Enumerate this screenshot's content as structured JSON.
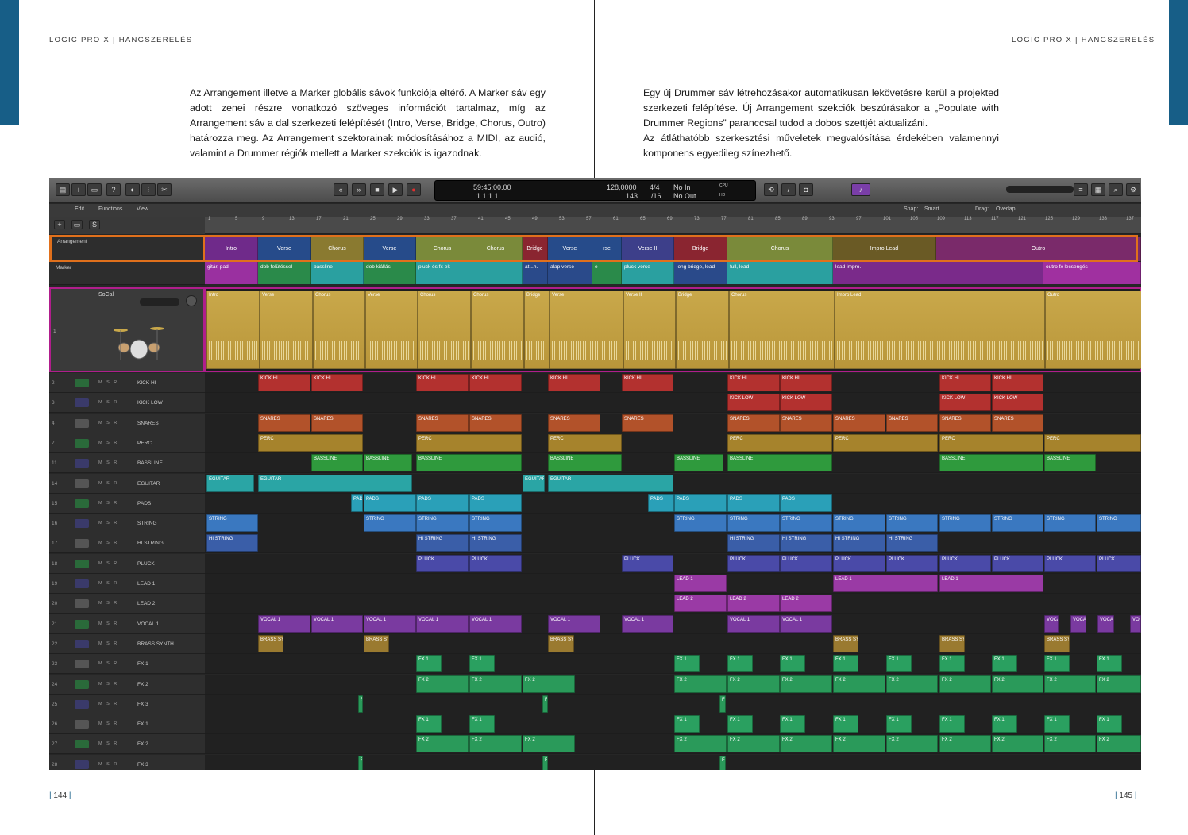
{
  "left_page": {
    "running_head": "LOGIC PRO X | HANGSZERELÉS",
    "paragraph": "Az Arrangement illetve a Marker globális sávok funkciója eltérő. A Marker sáv egy adott zenei részre vonatkozó szöveges információt tartalmaz, míg az Arrangement sáv a dal szerkezeti felépítését (Intro, Verse, Bridge, Chorus, Outro) határozza meg. Az Arrangement szektorainak módosításához a MIDI, az audió, valamint a Drummer régiók mellett a Marker szekciók is igazodnak.",
    "page_number": "144"
  },
  "right_page": {
    "running_head": "LOGIC PRO X | HANGSZERELÉS",
    "paragraph1": "Egy új Drummer sáv létrehozásakor automatikusan lekövetésre kerül a projekted szerkezeti felépítése. Új Arrangement szekciók beszúrásakor a „Populate with Drummer Regions” paranccsal tudod a dobos szettjét aktualizáni.",
    "paragraph2": "Az átláthatóbb szerkesztési műveletek megvalósítása érdekében valamennyi komponens egyedileg színezhető.",
    "page_number": "145"
  },
  "colors": {
    "accent": "#175e87",
    "arrangement_outline": "#e0701c",
    "drummer_outline": "#b01e8c"
  },
  "logic": {
    "lcd": {
      "position": "59:45:00.00",
      "bars": "1  1  1  1",
      "tempo": "128,0000",
      "timesig": "4/4",
      "division": "/16",
      "key_info": "143",
      "in": "No In",
      "out": "No Out",
      "cpu": "CPU",
      "hd": "HD"
    },
    "menu": {
      "edit": "Edit",
      "functions": "Functions",
      "view": "View"
    },
    "snap": {
      "snap_label": "Snap:",
      "snap_value": "Smart",
      "drag_label": "Drag:",
      "drag_value": "Overlap"
    },
    "ruler": [
      "1",
      "5",
      "9",
      "13",
      "17",
      "21",
      "25",
      "29",
      "33",
      "37",
      "41",
      "45",
      "49",
      "53",
      "57",
      "61",
      "65",
      "69",
      "73",
      "77",
      "81",
      "85",
      "89",
      "93",
      "97",
      "101",
      "105",
      "109",
      "113",
      "117",
      "121",
      "125",
      "129",
      "133",
      "137"
    ],
    "arrangement_label": "Arrangement",
    "marker_label": "Marker",
    "drummer_name": "SoCal",
    "drummer_num": "1",
    "arrangement": [
      {
        "label": "Intro",
        "color": "#6f2a8a"
      },
      {
        "label": "Verse",
        "color": "#264b8a"
      },
      {
        "label": "Chorus",
        "color": "#8a7a30"
      },
      {
        "label": "Verse",
        "color": "#264b8a"
      },
      {
        "label": "Chorus",
        "color": "#7a8a3a"
      },
      {
        "label": "Chorus",
        "color": "#7a8a3a"
      },
      {
        "label": "Bridge",
        "color": "#8a2530"
      },
      {
        "label": "Verse",
        "color": "#264b8a"
      },
      {
        "label": "rse",
        "color": "#264b8a"
      },
      {
        "label": "Verse II",
        "color": "#3d3f8a"
      },
      {
        "label": "Bridge",
        "color": "#8a2530"
      },
      {
        "label": "Chorus",
        "color": "#7a8a3a"
      },
      {
        "label": "Impro Lead",
        "color": "#6a5a25"
      },
      {
        "label": "Outro",
        "color": "#7a2a6a"
      }
    ],
    "markers": [
      {
        "label": "gitár, pad",
        "color": "#9a30a0"
      },
      {
        "label": "dob felütéssel",
        "color": "#2a8a4a"
      },
      {
        "label": "bassline",
        "color": "#2aa0a0"
      },
      {
        "label": "dob kiállás",
        "color": "#2a8a4a"
      },
      {
        "label": "pluck és fx-ek",
        "color": "#2aa0a0"
      },
      {
        "label": "at...h.",
        "color": "#2a4a8a"
      },
      {
        "label": "alap verse",
        "color": "#2a4a8a"
      },
      {
        "label": "e",
        "color": "#2a8a4a"
      },
      {
        "label": "pluck verse",
        "color": "#2aa0a0"
      },
      {
        "label": "long bridge, lead",
        "color": "#2a4a8a"
      },
      {
        "label": "full, lead",
        "color": "#2aa0a0"
      },
      {
        "label": "lead impro.",
        "color": "#7a2a8a"
      },
      {
        "label": "outro fx lecsengés",
        "color": "#a030a0"
      }
    ],
    "drummer_regions": [
      "Intro",
      "Verse",
      "Chorus",
      "Verse",
      "Chorus",
      "Chorus",
      "Bridge",
      "Verse",
      "Verse II",
      "Bridge",
      "Chorus",
      "Impro Lead",
      "Outro"
    ],
    "tracks": [
      {
        "num": "2",
        "name": "KICK HI",
        "region": "KICK HI",
        "color": "#b3312f"
      },
      {
        "num": "3",
        "name": "KICK LOW",
        "region": "KICK LOW",
        "color": "#b3312f"
      },
      {
        "num": "4",
        "name": "SNARES",
        "region": "SNARES",
        "color": "#b2522a"
      },
      {
        "num": "7",
        "name": "PERC",
        "region": "PERC",
        "color": "#a6832c"
      },
      {
        "num": "11",
        "name": "BASSLINE",
        "region": "BASSLINE",
        "color": "#2f9a3d"
      },
      {
        "num": "14",
        "name": "EGUITAR",
        "region": "EGUITAR",
        "color": "#2aa5a5"
      },
      {
        "num": "15",
        "name": "PADS",
        "region": "PADS",
        "color": "#2aa0b8"
      },
      {
        "num": "16",
        "name": "STRING",
        "region": "STRING",
        "color": "#3a78c0"
      },
      {
        "num": "17",
        "name": "HI STRING",
        "region": "HI STRING",
        "color": "#3a5ea8"
      },
      {
        "num": "18",
        "name": "PLUCK",
        "region": "PLUCK",
        "color": "#4a4aa8"
      },
      {
        "num": "19",
        "name": "LEAD 1",
        "region": "LEAD 1",
        "color": "#9a3aa5"
      },
      {
        "num": "20",
        "name": "LEAD 2",
        "region": "LEAD 2",
        "color": "#9a3aa5"
      },
      {
        "num": "21",
        "name": "VOCAL 1",
        "region": "VOCAL 1",
        "color": "#7a3aa0"
      },
      {
        "num": "22",
        "name": "BRASS SYNTH",
        "region": "BRASS SY",
        "color": "#9a7a30"
      },
      {
        "num": "23",
        "name": "FX 1",
        "region": "FX 1",
        "color": "#2aa060"
      },
      {
        "num": "24",
        "name": "FX 2",
        "region": "FX 2",
        "color": "#2a9a5a"
      },
      {
        "num": "25",
        "name": "FX 3",
        "region": "F",
        "color": "#2a9a5a"
      },
      {
        "num": "26",
        "name": "FX 1",
        "region": "FX 1",
        "color": "#2aa060"
      },
      {
        "num": "27",
        "name": "FX 2",
        "region": "FX 2",
        "color": "#2a9a5a"
      },
      {
        "num": "28",
        "name": "FX 3",
        "region": "F",
        "color": "#2a9a5a"
      }
    ]
  }
}
